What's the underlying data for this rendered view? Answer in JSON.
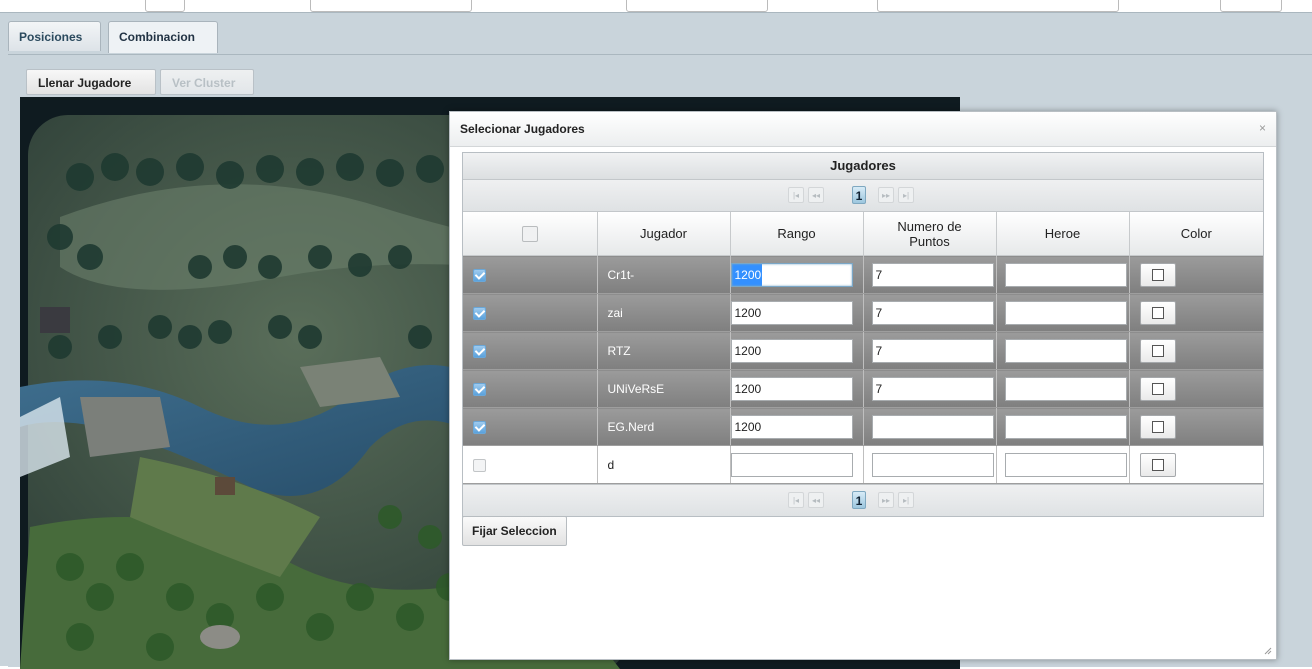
{
  "tabs": [
    {
      "label": "Posiciones",
      "active": false
    },
    {
      "label": "Combinacion",
      "active": true
    }
  ],
  "toolbar": {
    "fill_label": "Llenar Jugadore",
    "view_cluster_label": "Ver Cluster",
    "view_cluster_disabled": true
  },
  "dialog": {
    "title": "Selecionar Jugadores",
    "close_label": "×",
    "grid": {
      "caption": "Jugadores",
      "columns": [
        "Jugador",
        "Rango",
        "Numero de Puntos",
        "Heroe",
        "Color"
      ],
      "rows": [
        {
          "checked": true,
          "jugador": "Cr1t-",
          "rango": "1200",
          "puntos": "7",
          "heroe": ""
        },
        {
          "checked": true,
          "jugador": "zai",
          "rango": "1200",
          "puntos": "7",
          "heroe": ""
        },
        {
          "checked": true,
          "jugador": "RTZ",
          "rango": "1200",
          "puntos": "7",
          "heroe": ""
        },
        {
          "checked": true,
          "jugador": "UNiVeRsE",
          "rango": "1200",
          "puntos": "7",
          "heroe": ""
        },
        {
          "checked": true,
          "jugador": "EG.Nerd",
          "rango": "1200",
          "puntos": "",
          "heroe": ""
        },
        {
          "checked": false,
          "jugador": "d",
          "rango": "",
          "puntos": "",
          "heroe": ""
        }
      ],
      "pager": {
        "current_page": "1",
        "first": "|◂",
        "prev": "◂◂",
        "next": "▸▸",
        "last": "▸|"
      }
    },
    "submit_label": "Fijar Seleccion"
  }
}
